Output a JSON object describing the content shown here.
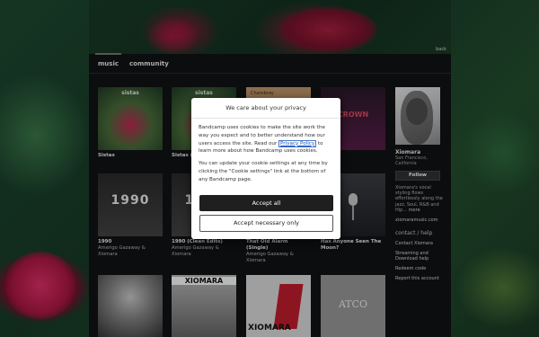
{
  "header": {
    "back_label": "back"
  },
  "nav": {
    "tabs": [
      {
        "label": "music"
      },
      {
        "label": "community"
      }
    ]
  },
  "albums": [
    {
      "title": "Sistas",
      "artist": "",
      "cover_text": "sistas"
    },
    {
      "title": "Sistas (Clean Edits)",
      "artist": "",
      "cover_text": "sistas"
    },
    {
      "title": "",
      "artist": "",
      "cover_text": "Chambray"
    },
    {
      "title": "",
      "artist": "",
      "cover_text": "CROWN"
    },
    {
      "title": "1990",
      "artist": "Amerigo Gazaway & Xiomara",
      "cover_text": "1990"
    },
    {
      "title": "1990 (Clean Edits)",
      "artist": "Amerigo Gazaway & Xiomara",
      "cover_text": "1990"
    },
    {
      "title": "That Old Alarm (Single)",
      "artist": "Amerigo Gazaway & Xiomara",
      "cover_text": ""
    },
    {
      "title": "Has Anyone Seen The Moon?",
      "artist": "",
      "cover_text": ""
    },
    {
      "title": "",
      "artist": "",
      "cover_text": ""
    },
    {
      "title": "",
      "artist": "",
      "cover_text": "XIOMARA"
    },
    {
      "title": "",
      "artist": "",
      "cover_text": "XIOMARA"
    },
    {
      "title": "",
      "artist": "",
      "cover_text": "ATCO"
    }
  ],
  "sidebar": {
    "artist_name": "Xiomara",
    "location": "San Francisco, California",
    "follow_label": "Follow",
    "bio": "Xiomara's vocal styling flows effortlessly along the jazz, Soul, R&B and Hip...",
    "bio_more": "more",
    "website": "xiomaramusic.com",
    "contact_heading": "contact / help",
    "links": [
      {
        "label": "Contact Xiomara"
      },
      {
        "label": "Streaming and Download help"
      },
      {
        "label": "Redeem code"
      },
      {
        "label": "Report this account"
      }
    ]
  },
  "cookie_modal": {
    "title": "We care about your privacy",
    "text_before_link": "Bandcamp uses cookies to make the site work the way you expect and to better understand how our users access the site. Read our ",
    "link_label": "Privacy Policy",
    "text_after_link": " to learn more about how Bandcamp uses cookies.",
    "text2": "You can update your cookie settings at any time by clicking the \"Cookie settings\" link at the bottom of any Bandcamp page.",
    "accept_all_label": "Accept all",
    "accept_necessary_label": "Accept necessary only"
  },
  "colors": {
    "page_bg": "#111214",
    "accept_button_bg": "#1f1f1f",
    "link": "#1a53b8"
  }
}
